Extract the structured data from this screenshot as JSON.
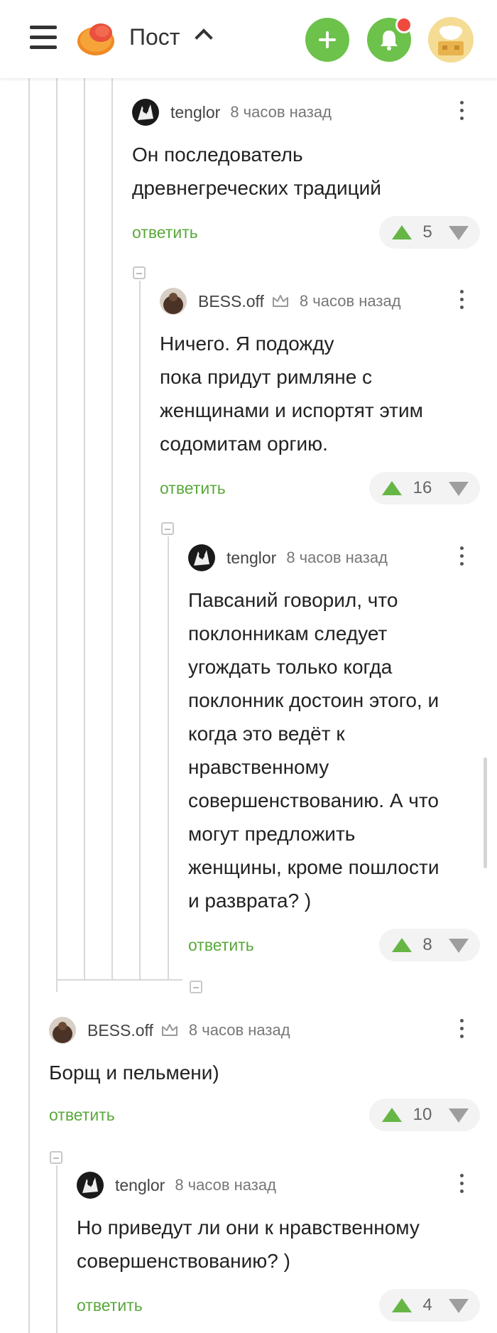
{
  "header": {
    "title": "Пост",
    "icons": [
      "menu-icon",
      "pikabu-logo",
      "chevron-up-icon",
      "plus-icon",
      "bell-icon",
      "profile-avatar"
    ],
    "accent_color": "#6cc24a",
    "notification_color": "#ee4b3e"
  },
  "comments": [
    {
      "author": "tenglor",
      "time": "8 часов назад",
      "lines": [
        "Он последователь",
        "древнегреческих традиций"
      ],
      "reply": "ответить",
      "votes": "5"
    },
    {
      "author": "BESS.off",
      "time": "8 часов назад",
      "lines": [
        "Ничего. Я подожду",
        "пока придут римляне с",
        "женщинами и испортят этим",
        "содомитам оргию."
      ],
      "reply": "ответить",
      "votes": "16"
    },
    {
      "author": "tenglor",
      "time": "8 часов назад",
      "lines": [
        "Павсаний говорил, что",
        "поклонникам следует",
        "угождать только когда",
        "поклонник достоин этого, и",
        "когда это ведёт к",
        "нравственному",
        "совершенствованию. А что",
        "могут предложить",
        "женщины, кроме пошлости",
        "и разврата? )"
      ],
      "reply": "ответить",
      "votes": "8"
    },
    {
      "author": "BESS.off",
      "time": "8 часов назад",
      "lines": [
        "Борщ и пельмени)"
      ],
      "reply": "ответить",
      "votes": "10"
    },
    {
      "author": "tenglor",
      "time": "8 часов назад",
      "lines": [
        "Но приведут ли они к нравственному",
        "совершенствованию? )"
      ],
      "reply": "ответить",
      "votes": "4"
    }
  ]
}
